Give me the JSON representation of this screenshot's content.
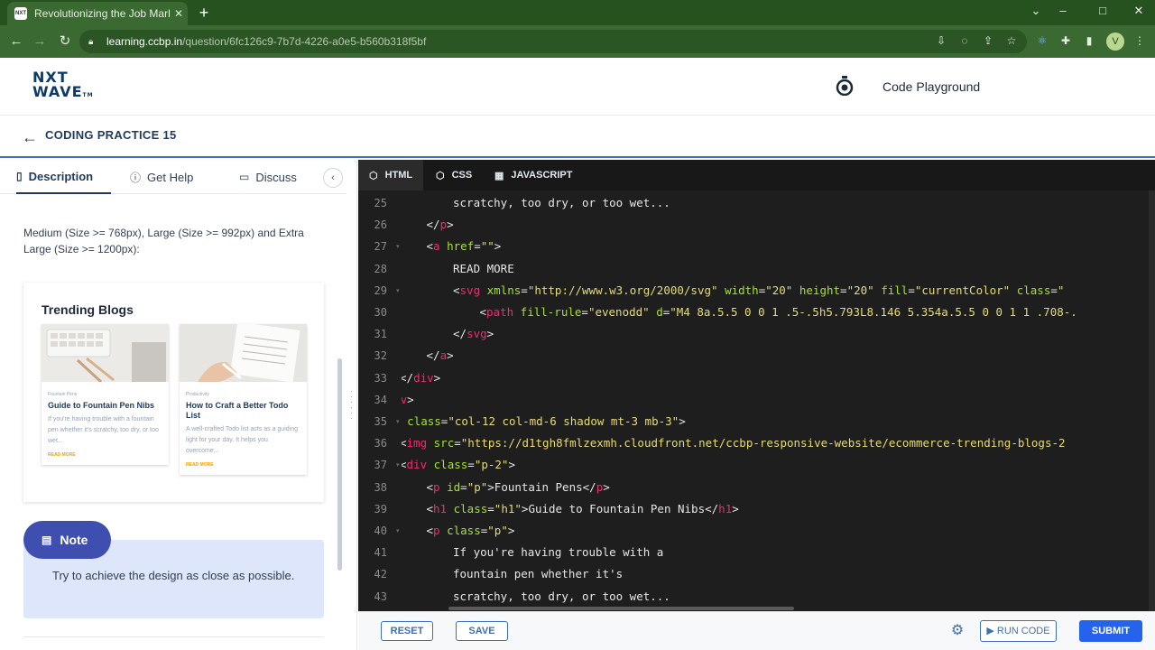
{
  "browser": {
    "tab_title": "Revolutionizing the Job Market |",
    "favicon_text": "NXT",
    "url_host": "learning.ccbp.in",
    "url_path": "/question/6fc126c9-7b7d-4226-a0e5-b560b318f5bf",
    "profile_initial": "V"
  },
  "header": {
    "logo_line1": "NXT",
    "logo_line2": "WAVE",
    "logo_tm": "TM",
    "playground_label": "Code Playground"
  },
  "practice": {
    "title": "CODING PRACTICE 15"
  },
  "left_tabs": [
    {
      "label": "Description",
      "icon": "document-icon"
    },
    {
      "label": "Get Help",
      "icon": "help-circle-icon"
    },
    {
      "label": "Discuss",
      "icon": "chat-icon"
    }
  ],
  "description": {
    "text": "Medium (Size >= 768px), Large (Size >= 992px) and Extra Large (Size >= 1200px):"
  },
  "preview": {
    "title": "Trending Blogs",
    "blogs": [
      {
        "category": "Fountain Pens",
        "heading": "Guide to Fountain Pen Nibs",
        "body": "If you're having trouble with a fountain pen whether it's scratchy, too dry, or too wet...",
        "more": "READ MORE"
      },
      {
        "category": "Productivity",
        "heading": "How to Craft a Better Todo List",
        "body": "A well-crafted Todo list acts as a guiding light for your day. It helps you overcome...",
        "more": "READ MORE"
      }
    ]
  },
  "note": {
    "label": "Note",
    "text": "Try to achieve the design as close as possible."
  },
  "editor_tabs": [
    {
      "label": "HTML",
      "icon": "html5-icon"
    },
    {
      "label": "CSS",
      "icon": "css3-icon"
    },
    {
      "label": "JAVASCRIPT",
      "icon": "js-file-icon"
    }
  ],
  "code_lines": [
    {
      "n": "25",
      "indent": 6,
      "tokens": [
        [
          "t",
          "scratchy, too dry, or too wet..."
        ]
      ]
    },
    {
      "n": "26",
      "indent": 5,
      "tokens": [
        [
          "p",
          "</"
        ],
        [
          "g",
          "p"
        ],
        [
          "p",
          ">"
        ]
      ]
    },
    {
      "n": "27",
      "indent": 5,
      "fold": true,
      "tokens": [
        [
          "p",
          "<"
        ],
        [
          "g",
          "a"
        ],
        [
          "t",
          " "
        ],
        [
          "a",
          "href"
        ],
        [
          "p",
          "="
        ],
        [
          "s",
          "\"\""
        ],
        [
          "p",
          ">"
        ]
      ]
    },
    {
      "n": "28",
      "indent": 6,
      "tokens": [
        [
          "t",
          "READ MORE"
        ]
      ]
    },
    {
      "n": "29",
      "indent": 6,
      "fold": true,
      "tokens": [
        [
          "p",
          "<"
        ],
        [
          "g",
          "svg"
        ],
        [
          "t",
          " "
        ],
        [
          "a",
          "xmlns"
        ],
        [
          "p",
          "="
        ],
        [
          "s",
          "\"http://www.w3.org/2000/svg\""
        ],
        [
          "t",
          " "
        ],
        [
          "a",
          "width"
        ],
        [
          "p",
          "="
        ],
        [
          "s",
          "\"20\""
        ],
        [
          "t",
          " "
        ],
        [
          "a",
          "height"
        ],
        [
          "p",
          "="
        ],
        [
          "s",
          "\"20\""
        ],
        [
          "t",
          " "
        ],
        [
          "a",
          "fill"
        ],
        [
          "p",
          "="
        ],
        [
          "s",
          "\"currentColor\""
        ],
        [
          "t",
          " "
        ],
        [
          "a",
          "class"
        ],
        [
          "p",
          "="
        ],
        [
          "s",
          "\""
        ]
      ]
    },
    {
      "n": "30",
      "indent": 7,
      "tokens": [
        [
          "p",
          "<"
        ],
        [
          "g",
          "path"
        ],
        [
          "t",
          " "
        ],
        [
          "a",
          "fill-rule"
        ],
        [
          "p",
          "="
        ],
        [
          "s",
          "\"evenodd\""
        ],
        [
          "t",
          " "
        ],
        [
          "a",
          "d"
        ],
        [
          "p",
          "="
        ],
        [
          "s",
          "\"M4 8a.5.5 0 0 1 .5-.5h5.793L8.146 5.354a.5.5 0 0 1 1 .708-."
        ]
      ]
    },
    {
      "n": "31",
      "indent": 6,
      "tokens": [
        [
          "p",
          "</"
        ],
        [
          "g",
          "svg"
        ],
        [
          "p",
          ">"
        ]
      ]
    },
    {
      "n": "32",
      "indent": 5,
      "tokens": [
        [
          "p",
          "</"
        ],
        [
          "g",
          "a"
        ],
        [
          "p",
          ">"
        ]
      ]
    },
    {
      "n": "33",
      "indent": 4,
      "tokens": [
        [
          "p",
          "</"
        ],
        [
          "g",
          "div"
        ],
        [
          "p",
          ">"
        ]
      ]
    },
    {
      "n": "34",
      "indent": 3,
      "tokens": [
        [
          "p",
          "</"
        ],
        [
          "g",
          "div"
        ],
        [
          "p",
          ">"
        ]
      ]
    },
    {
      "n": "35",
      "indent": 3,
      "fold": true,
      "tokens": [
        [
          "p",
          "<"
        ],
        [
          "g",
          "div"
        ],
        [
          "t",
          " "
        ],
        [
          "a",
          "class"
        ],
        [
          "p",
          "="
        ],
        [
          "s",
          "\"col-12 col-md-6 shadow mt-3 mb-3\""
        ],
        [
          "p",
          ">"
        ]
      ]
    },
    {
      "n": "36",
      "indent": 4,
      "tokens": [
        [
          "p",
          "<"
        ],
        [
          "g",
          "img"
        ],
        [
          "t",
          " "
        ],
        [
          "a",
          "src"
        ],
        [
          "p",
          "="
        ],
        [
          "s",
          "\"https://d1tgh8fmlzexmh.cloudfront.net/ccbp-responsive-website/ecommerce-trending-blogs-2"
        ]
      ]
    },
    {
      "n": "37",
      "indent": 4,
      "fold": true,
      "tokens": [
        [
          "p",
          "<"
        ],
        [
          "g",
          "div"
        ],
        [
          "t",
          " "
        ],
        [
          "a",
          "class"
        ],
        [
          "p",
          "="
        ],
        [
          "s",
          "\"p-2\""
        ],
        [
          "p",
          ">"
        ]
      ]
    },
    {
      "n": "38",
      "indent": 5,
      "tokens": [
        [
          "p",
          "<"
        ],
        [
          "g",
          "p"
        ],
        [
          "t",
          " "
        ],
        [
          "a",
          "id"
        ],
        [
          "p",
          "="
        ],
        [
          "s",
          "\"p\""
        ],
        [
          "p",
          ">"
        ],
        [
          "t",
          "Fountain Pens"
        ],
        [
          "p",
          "</"
        ],
        [
          "g",
          "p"
        ],
        [
          "p",
          ">"
        ]
      ]
    },
    {
      "n": "39",
      "indent": 5,
      "tokens": [
        [
          "p",
          "<"
        ],
        [
          "g",
          "h1"
        ],
        [
          "t",
          " "
        ],
        [
          "a",
          "class"
        ],
        [
          "p",
          "="
        ],
        [
          "s",
          "\"h1\""
        ],
        [
          "p",
          ">"
        ],
        [
          "t",
          "Guide to Fountain Pen Nibs"
        ],
        [
          "p",
          "</"
        ],
        [
          "g",
          "h1"
        ],
        [
          "p",
          ">"
        ]
      ]
    },
    {
      "n": "40",
      "indent": 5,
      "fold": true,
      "tokens": [
        [
          "p",
          "<"
        ],
        [
          "g",
          "p"
        ],
        [
          "t",
          " "
        ],
        [
          "a",
          "class"
        ],
        [
          "p",
          "="
        ],
        [
          "s",
          "\"p\""
        ],
        [
          "p",
          ">"
        ]
      ]
    },
    {
      "n": "41",
      "indent": 6,
      "tokens": [
        [
          "t",
          "If you're having trouble with a"
        ]
      ]
    },
    {
      "n": "42",
      "indent": 6,
      "tokens": [
        [
          "t",
          "fountain pen whether it's"
        ]
      ]
    },
    {
      "n": "43",
      "indent": 6,
      "tokens": [
        [
          "t",
          "scratchy, too dry, or too wet..."
        ]
      ]
    }
  ],
  "bottom": {
    "reset_label": "RESET",
    "save_label": "SAVE",
    "run_label": "RUN CODE",
    "submit_label": "SUBMIT"
  },
  "colors": {
    "browser_frame": "#3a6a31",
    "primary": "#1e3a5f",
    "accent_blue": "#2563eb",
    "note_pill": "#3f4fb0",
    "editor_bg": "#1e1e1e",
    "tag": "#f92672",
    "attr": "#a6e22e",
    "string": "#e6db74"
  }
}
